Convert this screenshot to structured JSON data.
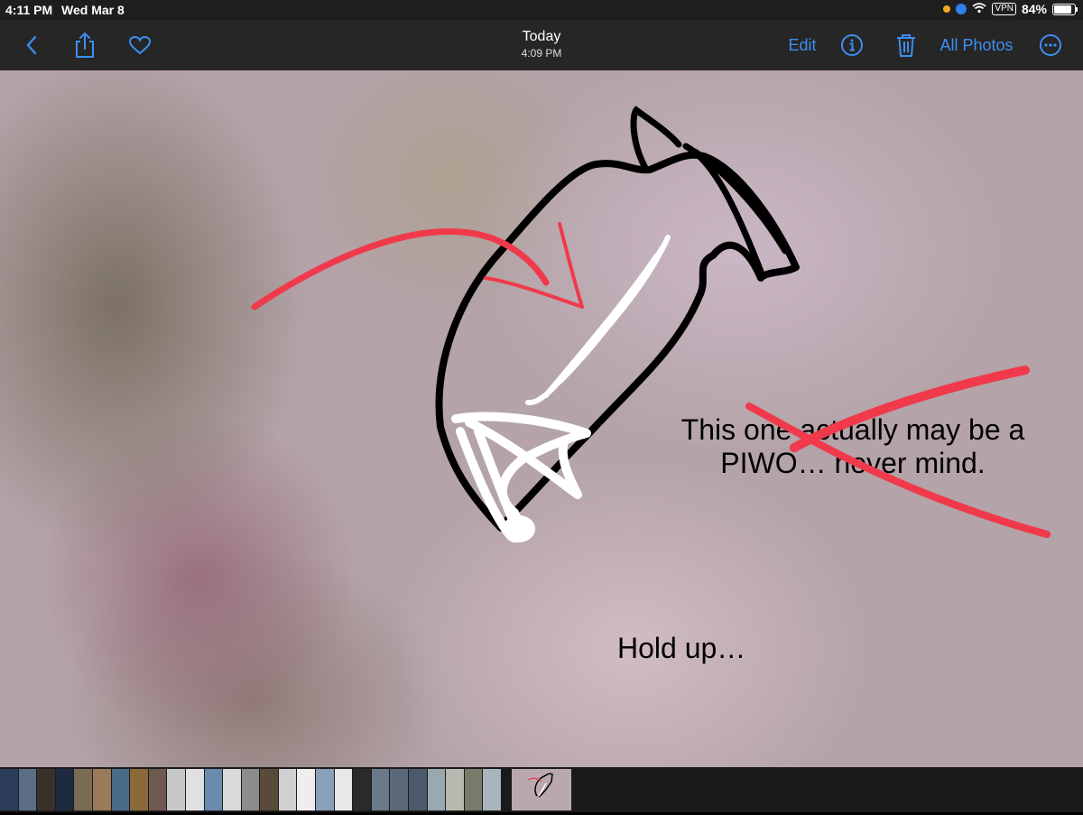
{
  "status_bar": {
    "time": "4:11 PM",
    "date": "Wed Mar 8",
    "vpn": "VPN",
    "battery": "84%"
  },
  "nav": {
    "title": "Today",
    "subtitle": "4:09 PM",
    "edit_label": "Edit",
    "all_photos_label": "All Photos",
    "icons": [
      "chevron-left-icon",
      "share-icon",
      "heart-icon",
      "info-icon",
      "trash-icon",
      "more-icon"
    ],
    "accent_color": "#3d8ef0"
  },
  "photo": {
    "annotation_text_1_line1": "This one actually may be a",
    "annotation_text_1_line2": "PIWO… never mind.",
    "annotation_text_2": "Hold up…",
    "pen_colors": {
      "black": "#000000",
      "red": "#f03a4b",
      "white": "#ffffff"
    }
  },
  "thumbnail_strip": {
    "thumbnail_colors": [
      "#2c3d5a",
      "#5a6f86",
      "#3b2f2a",
      "#1d2a40",
      "#7a6b55",
      "#9b7a5a",
      "#4a6a8a",
      "#8a6a3a",
      "#6f5a4f",
      "#c8c8c8",
      "#e0e0e0",
      "#6a8ab0",
      "#d9d9d9",
      "#8c8c8c",
      "#5a4a3a",
      "#d0d0d0",
      "#eeeeee",
      "#8aa0b8",
      "#e8e8e8",
      "#2a2a2a",
      "#6a7a8a",
      "#5a6a7a",
      "#4a5a6a",
      "#9aa8b0",
      "#b8b8b0",
      "#7a7a6a",
      "#aab4bc"
    ]
  }
}
